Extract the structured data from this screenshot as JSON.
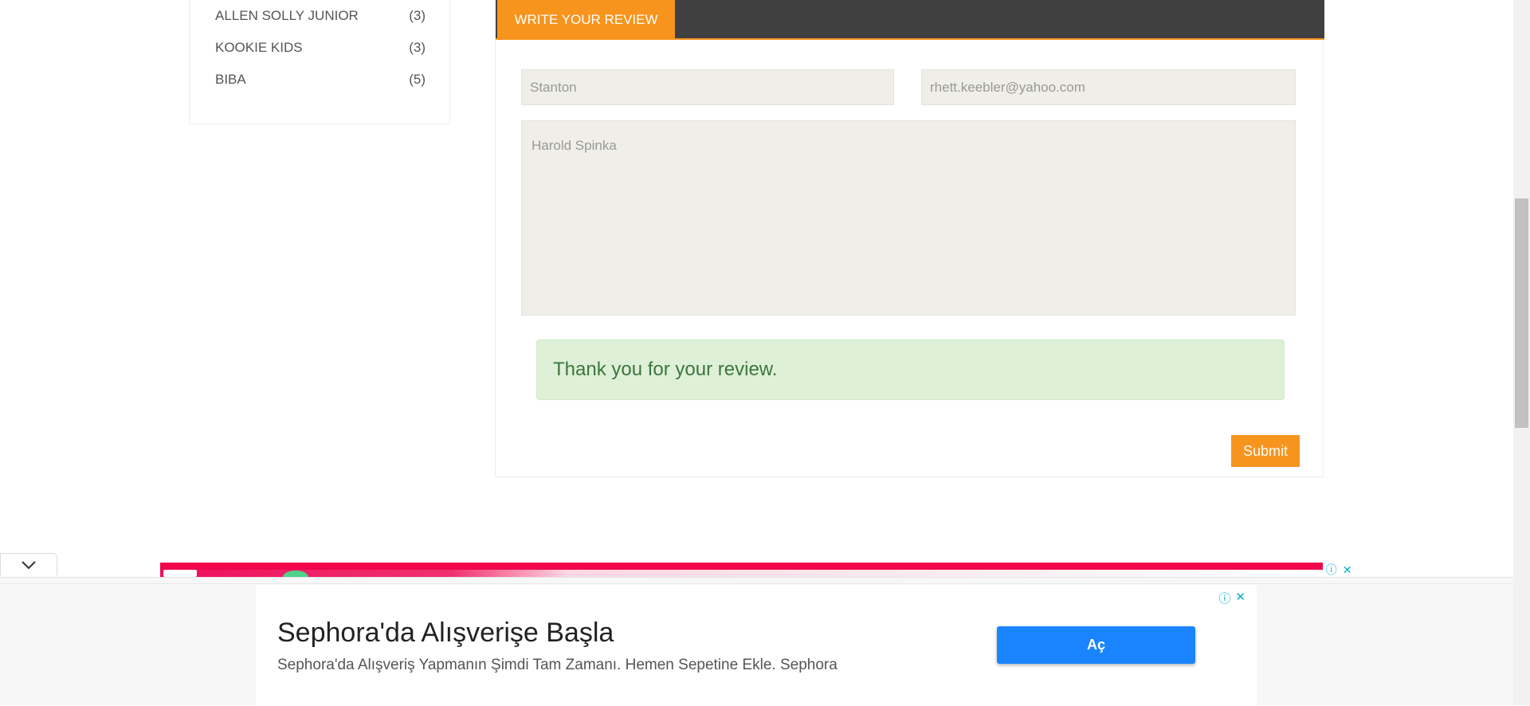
{
  "sidebar": {
    "brands": [
      {
        "name": "ALLEN SOLLY JUNIOR",
        "count": "(3)"
      },
      {
        "name": "KOOKIE KIDS",
        "count": "(3)"
      },
      {
        "name": "BIBA",
        "count": "(5)"
      }
    ]
  },
  "review": {
    "tab_label": "WRITE YOUR REVIEW",
    "name_value": "Stanton",
    "email_value": "rhett.keebler@yahoo.com",
    "review_text": "Harold Spinka",
    "success_message": "Thank you for your review.",
    "submit_label": "Submit"
  },
  "ad": {
    "title": "Sephora'da Alışverişe Başla",
    "description": "Sephora'da Alışveriş Yapmanın Şimdi Tam Zamanı. Hemen Sepetine Ekle. Sephora",
    "cta_label": "Aç",
    "info_glyph": "ⓘ",
    "close_glyph": "✕"
  },
  "colors": {
    "accent": "#f7941d",
    "header_dark": "#404040",
    "success_bg": "#dff0d8",
    "success_text": "#3c763d",
    "ad_cta": "#1a84ff"
  }
}
